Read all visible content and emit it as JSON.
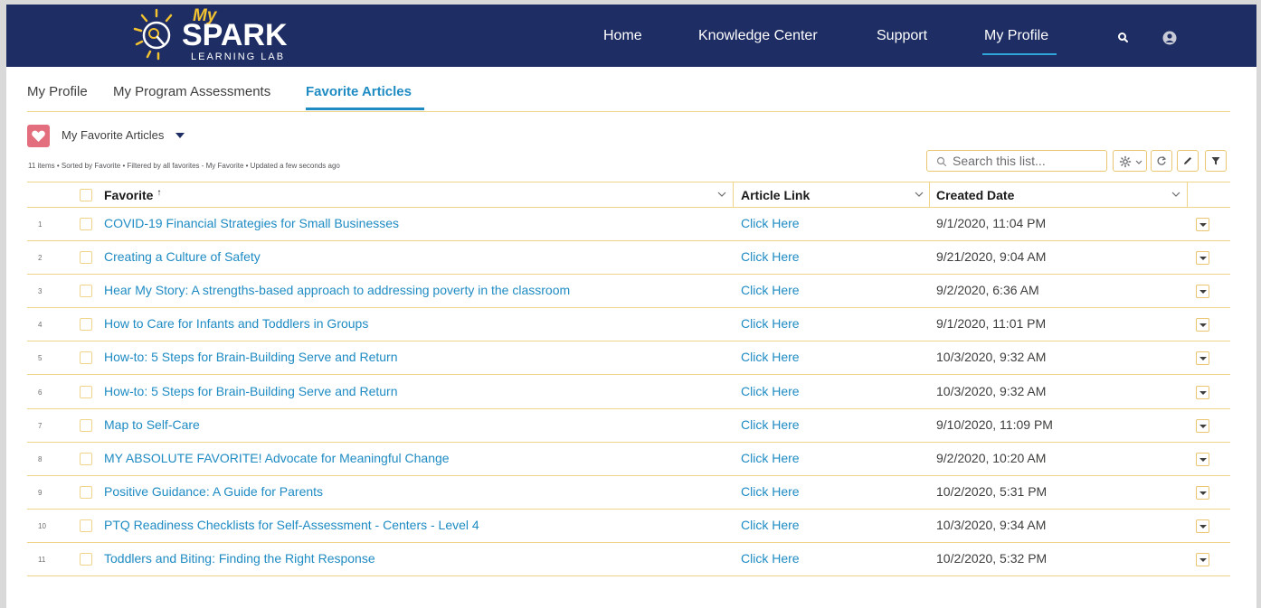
{
  "brand": {
    "my": "My",
    "name": "SPARK",
    "tagline": "LEARNING LAB",
    "accent": "#f2c230",
    "navy": "#1e2d63"
  },
  "nav": {
    "items": [
      {
        "label": "Home"
      },
      {
        "label": "Knowledge Center"
      },
      {
        "label": "Support"
      },
      {
        "label": "My Profile",
        "active": true
      }
    ],
    "search_icon": "search-icon",
    "user_icon": "user-avatar-icon"
  },
  "subtabs": [
    {
      "label": "My Profile"
    },
    {
      "label": "My Program Assessments"
    },
    {
      "label": "Favorite Articles",
      "active": true
    }
  ],
  "list": {
    "icon": "heart-icon",
    "title": "My Favorite Articles",
    "meta": "11 items • Sorted by Favorite • Filtered by all favorites - My Favorite • Updated a few seconds ago",
    "search_placeholder": "Search this list...",
    "tools": [
      "settings-gear-icon",
      "refresh-icon",
      "edit-pencil-icon",
      "filter-icon"
    ]
  },
  "table": {
    "columns": [
      "Favorite",
      "Article Link",
      "Created Date"
    ],
    "sort_indicator": "↑",
    "rows": [
      {
        "n": "1",
        "favorite": "COVID-19 Financial Strategies for Small Businesses",
        "link": "Click Here",
        "date": "9/1/2020, 11:04 PM"
      },
      {
        "n": "2",
        "favorite": "Creating a Culture of Safety",
        "link": "Click Here",
        "date": "9/21/2020, 9:04 AM"
      },
      {
        "n": "3",
        "favorite": "Hear My Story: A strengths-based approach to addressing poverty in the classroom",
        "link": "Click Here",
        "date": "9/2/2020, 6:36 AM"
      },
      {
        "n": "4",
        "favorite": "How to Care for Infants and Toddlers in Groups",
        "link": "Click Here",
        "date": "9/1/2020, 11:01 PM"
      },
      {
        "n": "5",
        "favorite": "How-to: 5 Steps for Brain-Building Serve and Return",
        "link": "Click Here",
        "date": "10/3/2020, 9:32 AM"
      },
      {
        "n": "6",
        "favorite": "How-to: 5 Steps for Brain-Building Serve and Return",
        "link": "Click Here",
        "date": "10/3/2020, 9:32 AM"
      },
      {
        "n": "7",
        "favorite": "Map to Self-Care",
        "link": "Click Here",
        "date": "9/10/2020, 11:09 PM"
      },
      {
        "n": "8",
        "favorite": "MY ABSOLUTE FAVORITE! Advocate for Meaningful Change",
        "link": "Click Here",
        "date": "9/2/2020, 10:20 AM"
      },
      {
        "n": "9",
        "favorite": "Positive Guidance: A Guide for Parents",
        "link": "Click Here",
        "date": "10/2/2020, 5:31 PM"
      },
      {
        "n": "10",
        "favorite": "PTQ Readiness Checklists for Self-Assessment - Centers - Level 4",
        "link": "Click Here",
        "date": "10/3/2020, 9:34 AM"
      },
      {
        "n": "11",
        "favorite": "Toddlers and Biting: Finding the Right Response",
        "link": "Click Here",
        "date": "10/2/2020, 5:32 PM"
      }
    ]
  }
}
